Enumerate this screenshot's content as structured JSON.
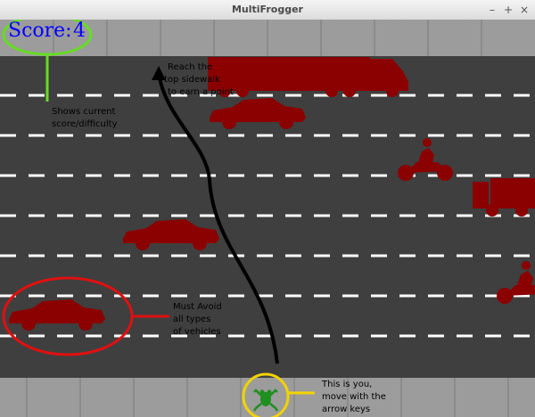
{
  "window": {
    "title": "MultiFrogger",
    "minimize_glyph": "–",
    "maximize_glyph": "+",
    "close_glyph": "×"
  },
  "hud": {
    "score_label": "Score:",
    "score_value": "4"
  },
  "annotations": {
    "goal_line1": "Reach the",
    "goal_line2": "top sidewalk",
    "goal_line3": "to earn a point",
    "score_line1": "Shows current",
    "score_line2": "score/difficulty",
    "avoid_line1": "Must Avoid",
    "avoid_line2": "all types",
    "avoid_line3": "of vehicles",
    "player_line1": "This is you,",
    "player_line2": "move with the",
    "player_line3": "arrow keys"
  },
  "colors": {
    "road": "#3f3f3f",
    "sidewalk": "#9c9c9c",
    "lane_dash": "#ffffff",
    "vehicle": "#8b0000",
    "frog": "#1f8f1f",
    "score_text": "#0000ff",
    "score_ring": "#66dd22",
    "vehicle_ring": "#e01010",
    "player_ring": "#f2d300",
    "arrow": "#000000"
  },
  "icons": {
    "frog": "frog-icon",
    "car": "car-icon",
    "truck": "truck-icon",
    "motorcycle": "motorcycle-icon"
  }
}
